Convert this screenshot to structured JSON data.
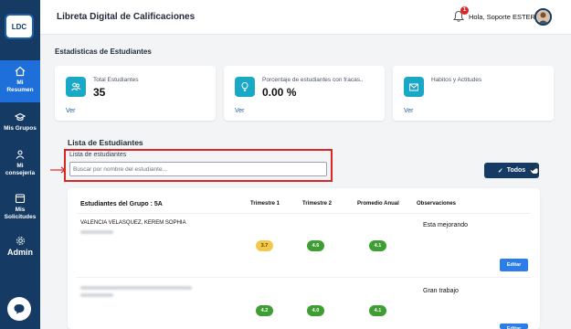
{
  "app": {
    "logo_text": "LDC",
    "title": "Libreta Digital de Calificaciones"
  },
  "user": {
    "greeting": "Hola, Soporte ESTER",
    "notifications": "1"
  },
  "sidebar": {
    "items": [
      {
        "label_line1": "Mi",
        "label_line2": "Resumen",
        "icon": "home-icon",
        "active": true
      },
      {
        "label_line1": "",
        "label_line2": "Mis Grupos",
        "icon": "graduation-cap-icon",
        "active": false
      },
      {
        "label_line1": "Mi",
        "label_line2": "consejería",
        "icon": "users-icon",
        "active": false
      },
      {
        "label_line1": "Mis",
        "label_line2": "Solicitudes",
        "icon": "calendar-icon",
        "active": false
      },
      {
        "label_line1": "",
        "label_line2": "Admin",
        "icon": "gear-icon",
        "active": false
      }
    ]
  },
  "stats": {
    "title": "Estadisticas de Estudiantes",
    "cards": [
      {
        "label": "Total Estudiantes",
        "value": "35",
        "link": "Ver",
        "icon": "users-icon"
      },
      {
        "label": "Porcentaje de estudiantes con fracas..",
        "value": "0.00 %",
        "link": "Ver",
        "icon": "lightbulb-icon"
      },
      {
        "label": "Habitos y Actitudes",
        "value": "",
        "link": "Ver",
        "icon": "envelope-icon"
      }
    ]
  },
  "list": {
    "title": "Lista de Estudiantes",
    "search_label": "Lista de estudiantes",
    "search_placeholder": "Buscar por nombre del estudiante...",
    "filter_button": "Todos"
  },
  "table": {
    "headers": {
      "group": "Estudiantes del Grupo : 5A",
      "t1": "Trimestre 1",
      "t2": "Trimestre 2",
      "avg": "Promedio Anual",
      "obs": "Observaciones"
    },
    "rows": [
      {
        "name": "VALENCIA VELASQUEZ, KEREM SOPHIA",
        "t1": "3.7",
        "t2": "4.6",
        "avg": "4.1",
        "observation": "Esta mejorando",
        "action": "Editar"
      },
      {
        "name": "",
        "t1": "4.2",
        "t2": "4.0",
        "avg": "4.1",
        "observation": "Gran trabajo",
        "action": "Editar"
      }
    ]
  },
  "colors": {
    "sidebar": "#153a63",
    "active_nav": "#1e6fd9",
    "grade_green": "#3f9e33",
    "grade_yellow": "#f2c94c",
    "highlight": "#dc2626",
    "accent_teal": "#1aa8c7"
  }
}
